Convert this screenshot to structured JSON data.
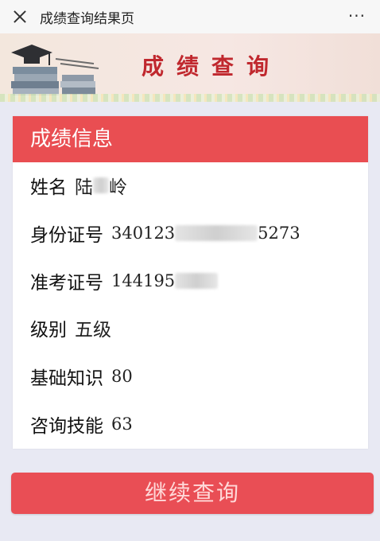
{
  "topbar": {
    "title": "成绩查询结果页",
    "more": "···"
  },
  "banner": {
    "title": "成绩查询"
  },
  "card": {
    "header": "成绩信息",
    "name": {
      "label": "姓名",
      "value_start": "陆",
      "value_end": "岭"
    },
    "id_card": {
      "label": "身份证号",
      "value_start": "340123",
      "value_end": "5273"
    },
    "cert_no": {
      "label": "准考证号",
      "value_start": "144195"
    },
    "level": {
      "label": "级别",
      "value": "五级"
    },
    "basic_knowledge": {
      "label": "基础知识",
      "value": "80"
    },
    "consulting_skill": {
      "label": "咨询技能",
      "value": "63"
    }
  },
  "actions": {
    "continue_label": "继续查询"
  },
  "colors": {
    "accent": "#e94e52",
    "banner_title": "#c0282e"
  }
}
